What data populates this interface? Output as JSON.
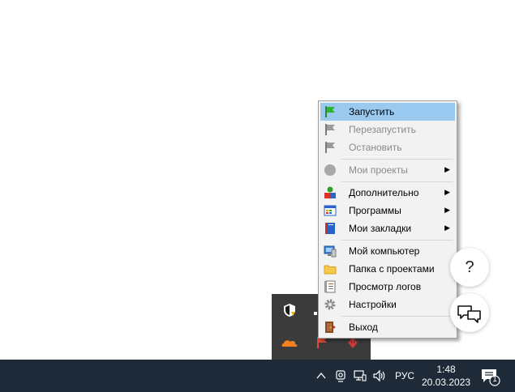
{
  "menu": {
    "items": [
      {
        "label": "Запустить",
        "icon": "green-flag-icon",
        "state": "selected"
      },
      {
        "label": "Перезапустить",
        "icon": "gray-flag-icon",
        "state": "disabled"
      },
      {
        "label": "Остановить",
        "icon": "gray-flag-icon",
        "state": "disabled"
      },
      {
        "label": "Мои проекты",
        "icon": "gray-circle-icon",
        "state": "disabled",
        "submenu": true
      },
      {
        "label": "Дополнительно",
        "icon": "color-shapes-icon",
        "state": "normal",
        "submenu": true
      },
      {
        "label": "Программы",
        "icon": "window-grid-icon",
        "state": "normal",
        "submenu": true
      },
      {
        "label": "Мои закладки",
        "icon": "bookmark-book-icon",
        "state": "normal",
        "submenu": true
      },
      {
        "label": "Мой компьютер",
        "icon": "computer-icon",
        "state": "normal"
      },
      {
        "label": "Папка с проектами",
        "icon": "folder-icon",
        "state": "normal"
      },
      {
        "label": "Просмотр логов",
        "icon": "log-notebook-icon",
        "state": "normal"
      },
      {
        "label": "Настройки",
        "icon": "gear-icon",
        "state": "normal"
      },
      {
        "label": "Выход",
        "icon": "exit-door-icon",
        "state": "normal"
      }
    ],
    "submenu_arrow": "▶"
  },
  "help_button": {
    "label": "?"
  },
  "taskbar": {
    "language": "РУС",
    "time": "1:48",
    "date": "20.03.2023",
    "notification_count": "1"
  },
  "colors": {
    "selection": "#99c9ef",
    "taskbar": "#1f2a38",
    "tray_overflow": "#3b3b3b"
  }
}
